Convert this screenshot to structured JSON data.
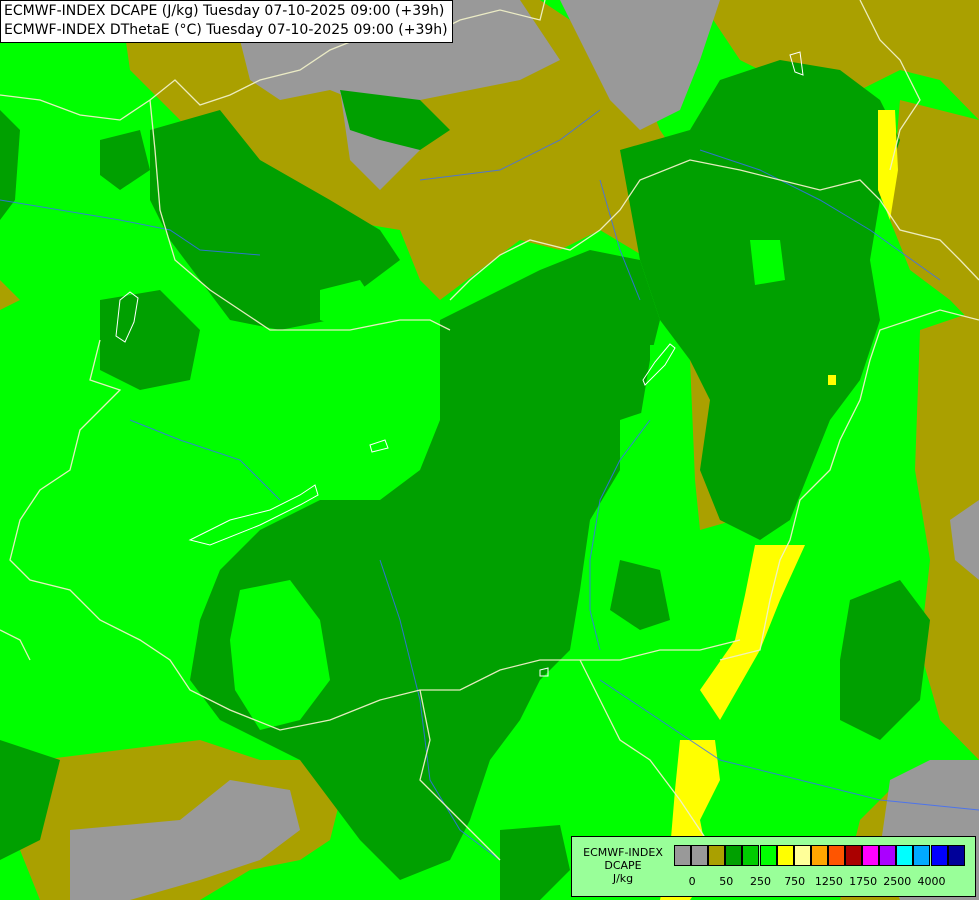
{
  "header": {
    "line1": "ECMWF-INDEX DCAPE (J/kg) Tuesday 07-10-2025 09:00 (+39h)",
    "line2": "ECMWF-INDEX DThetaE (°C) Tuesday 07-10-2025 09:00 (+39h)"
  },
  "legend": {
    "title_line1": "ECMWF-INDEX",
    "title_line2": "DCAPE",
    "title_line3": "J/kg",
    "colors": [
      "#999999",
      "#999999",
      "#aaa000",
      "#00a000",
      "#00cc00",
      "#00ff00",
      "#ffff00",
      "#ffff99",
      "#ffa500",
      "#ff5500",
      "#aa0000",
      "#ff00ff",
      "#aa00ff",
      "#00ffff",
      "#00aaff",
      "#0000ff",
      "#000099"
    ],
    "tick_labels": [
      "0",
      "50",
      "250",
      "750",
      "1250",
      "1750",
      "2500",
      "4000"
    ]
  },
  "map": {
    "colors": {
      "grey": "#999999",
      "olive": "#aaa000",
      "dark_green": "#00a000",
      "bright_green": "#00ff00",
      "yellow": "#ffff00",
      "border": "#f0f0c8",
      "river": "#3a6aff"
    }
  }
}
